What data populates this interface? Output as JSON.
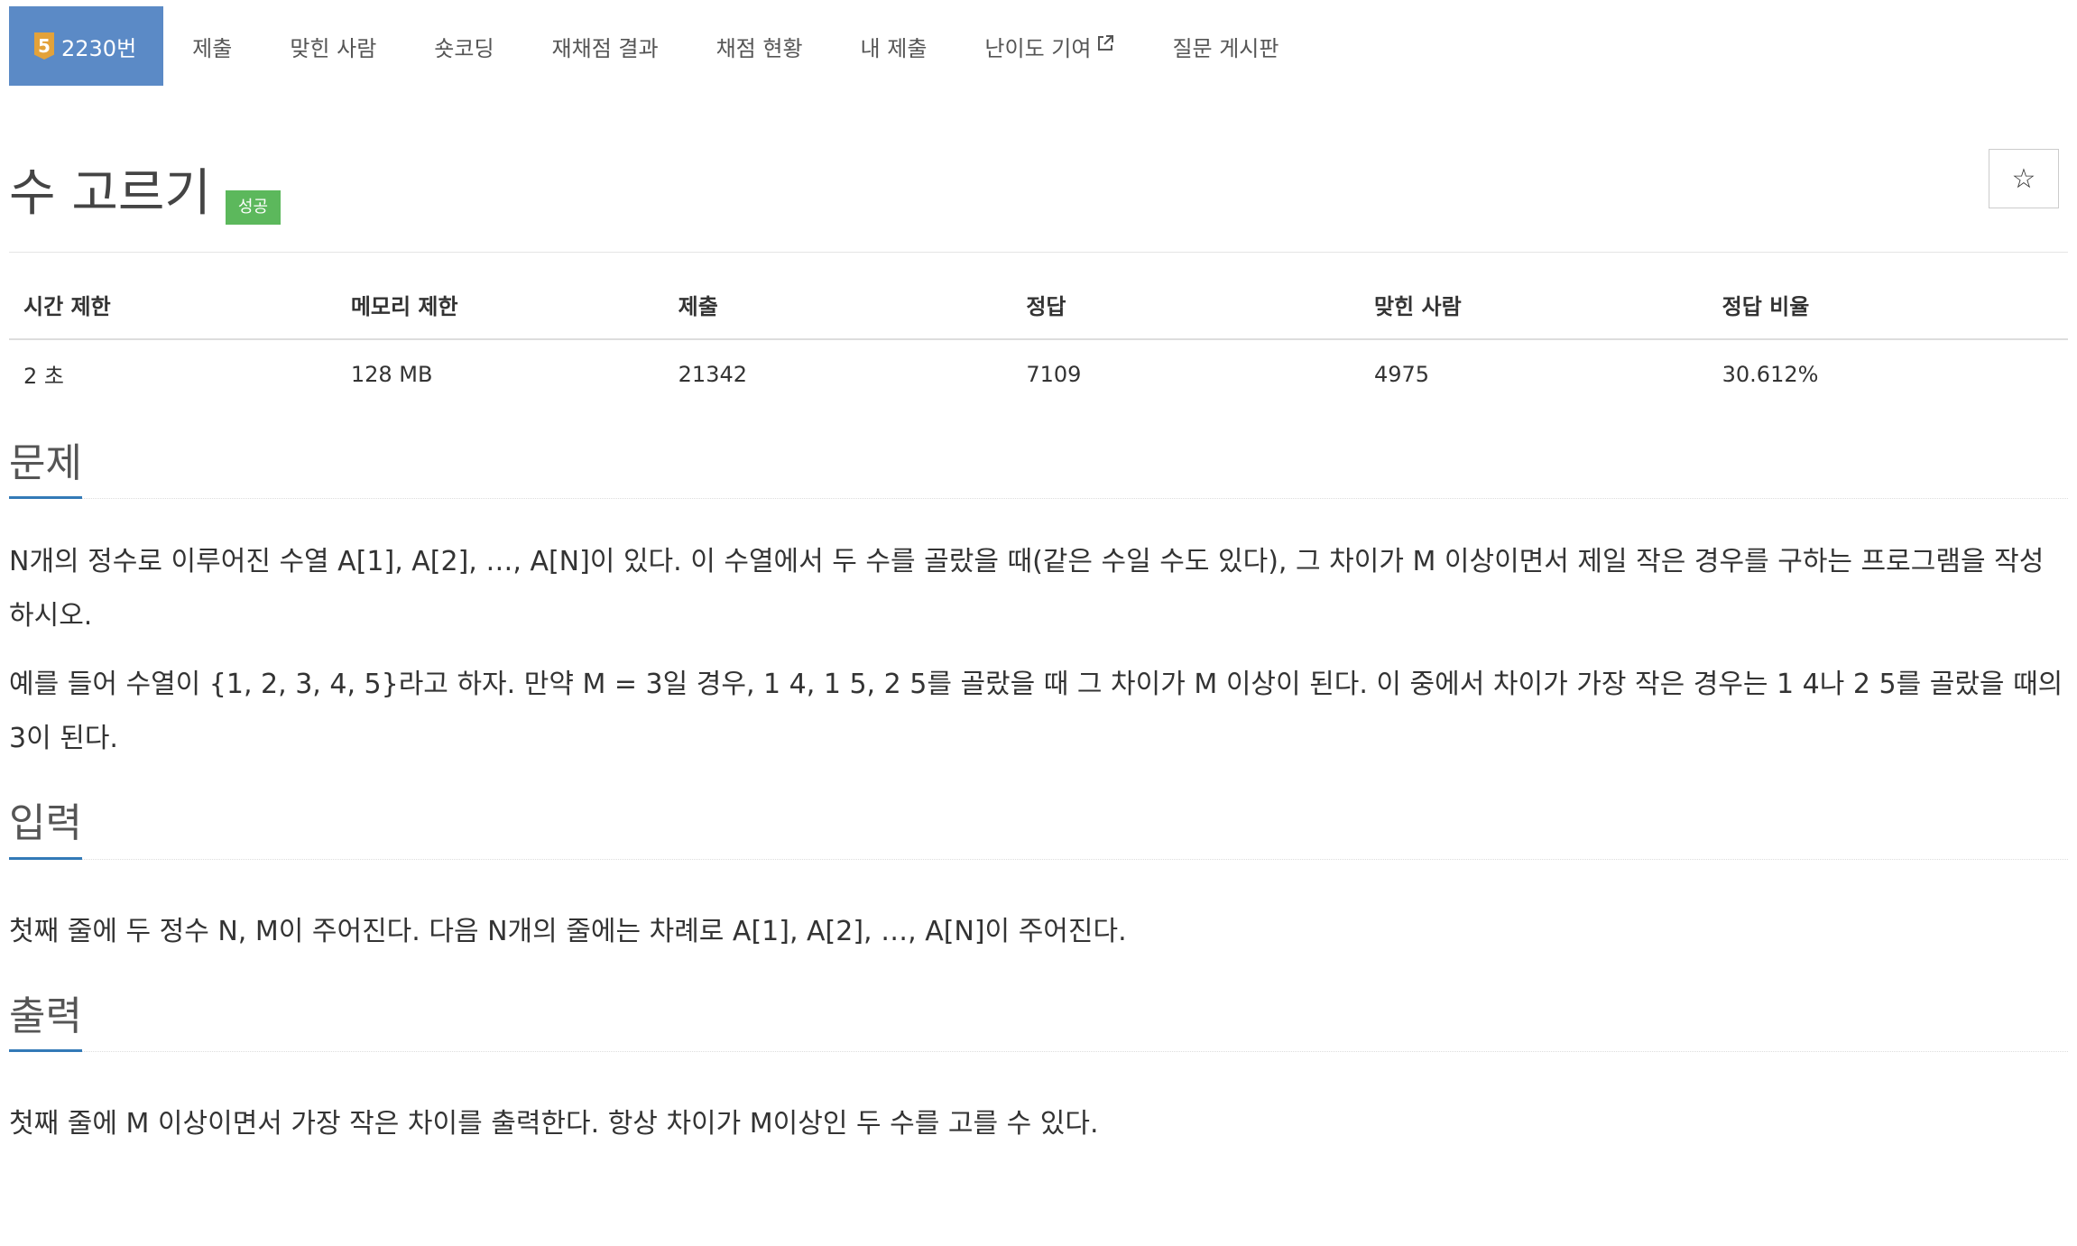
{
  "nav": {
    "tier": "5",
    "problem_number": "2230번",
    "tabs": [
      "제출",
      "맞힌 사람",
      "숏코딩",
      "재채점 결과",
      "채점 현황",
      "내 제출",
      "난이도 기여",
      "질문 게시판"
    ],
    "external_icon": "external-link-icon"
  },
  "colors": {
    "active_tab": "#5b8ac6",
    "tier_badge": "#e3a23a",
    "success_badge": "#5cb85c",
    "section_underline": "#337ab7"
  },
  "problem": {
    "title": "수 고르기",
    "status_badge": "성공",
    "star_glyph": "☆"
  },
  "info_table": {
    "headers": [
      "시간 제한",
      "메모리 제한",
      "제출",
      "정답",
      "맞힌 사람",
      "정답 비율"
    ],
    "values": [
      "2 초",
      "128 MB",
      "21342",
      "7109",
      "4975",
      "30.612%"
    ]
  },
  "sections": {
    "problem": {
      "title": "문제",
      "paragraphs": [
        "N개의 정수로 이루어진 수열 A[1], A[2], …, A[N]이 있다. 이 수열에서 두 수를 골랐을 때(같은 수일 수도 있다), 그 차이가 M 이상이면서 제일 작은 경우를 구하는 프로그램을 작성하시오.",
        "예를 들어 수열이 {1, 2, 3, 4, 5}라고 하자. 만약 M = 3일 경우, 1 4, 1 5, 2 5를 골랐을 때 그 차이가 M 이상이 된다. 이 중에서 차이가 가장 작은 경우는 1 4나 2 5를 골랐을 때의 3이 된다."
      ]
    },
    "input": {
      "title": "입력",
      "paragraphs": [
        "첫째 줄에 두 정수 N, M이 주어진다. 다음 N개의 줄에는 차례로 A[1], A[2], …, A[N]이 주어진다."
      ]
    },
    "output": {
      "title": "출력",
      "paragraphs": [
        "첫째 줄에 M 이상이면서 가장 작은 차이를 출력한다. 항상 차이가 M이상인 두 수를 고를 수 있다."
      ]
    }
  }
}
